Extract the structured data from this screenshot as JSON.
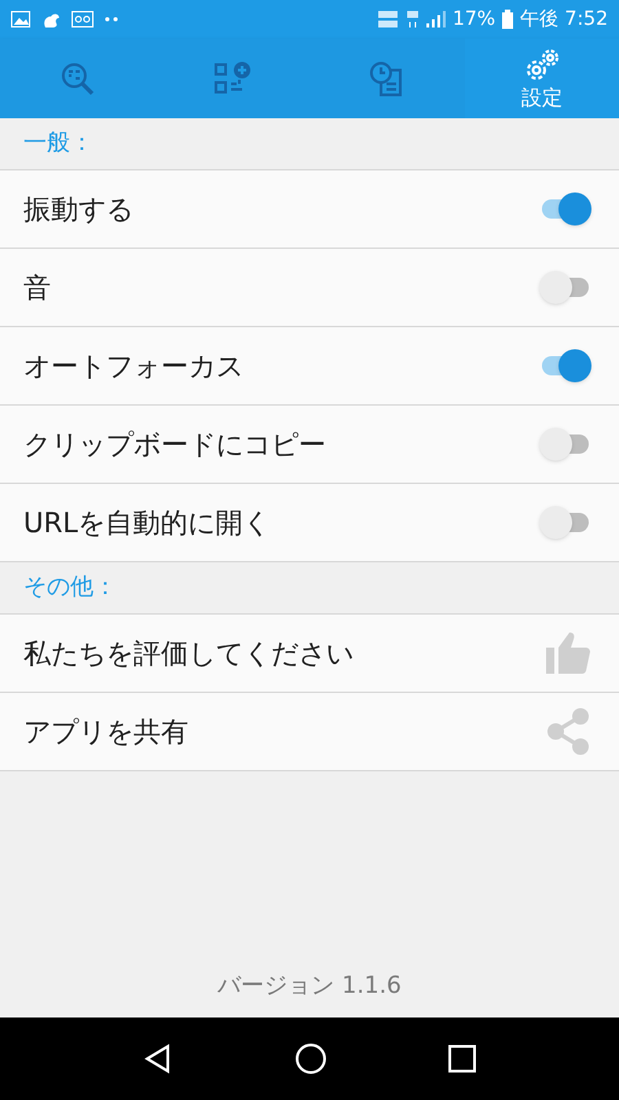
{
  "status_bar": {
    "battery": "17%",
    "time": "午後 7:52"
  },
  "tabs": [
    {
      "kind": "scan",
      "selected": false
    },
    {
      "kind": "create",
      "selected": false
    },
    {
      "kind": "history",
      "selected": false
    },
    {
      "kind": "settings",
      "label": "設定",
      "selected": true
    }
  ],
  "sections": [
    {
      "title": "一般：",
      "items": [
        {
          "kind": "toggle",
          "label": "振動する",
          "on": true
        },
        {
          "kind": "toggle",
          "label": "音",
          "on": false
        },
        {
          "kind": "toggle",
          "label": "オートフォーカス",
          "on": true
        },
        {
          "kind": "toggle",
          "label": "クリップボードにコピー",
          "on": false
        },
        {
          "kind": "toggle",
          "label": "URLを自動的に開く",
          "on": false
        }
      ]
    },
    {
      "title": "その他：",
      "items": [
        {
          "kind": "rate",
          "label": "私たちを評価してください"
        },
        {
          "kind": "share",
          "label": "アプリを共有"
        }
      ]
    }
  ],
  "version": "バージョン 1.1.6"
}
